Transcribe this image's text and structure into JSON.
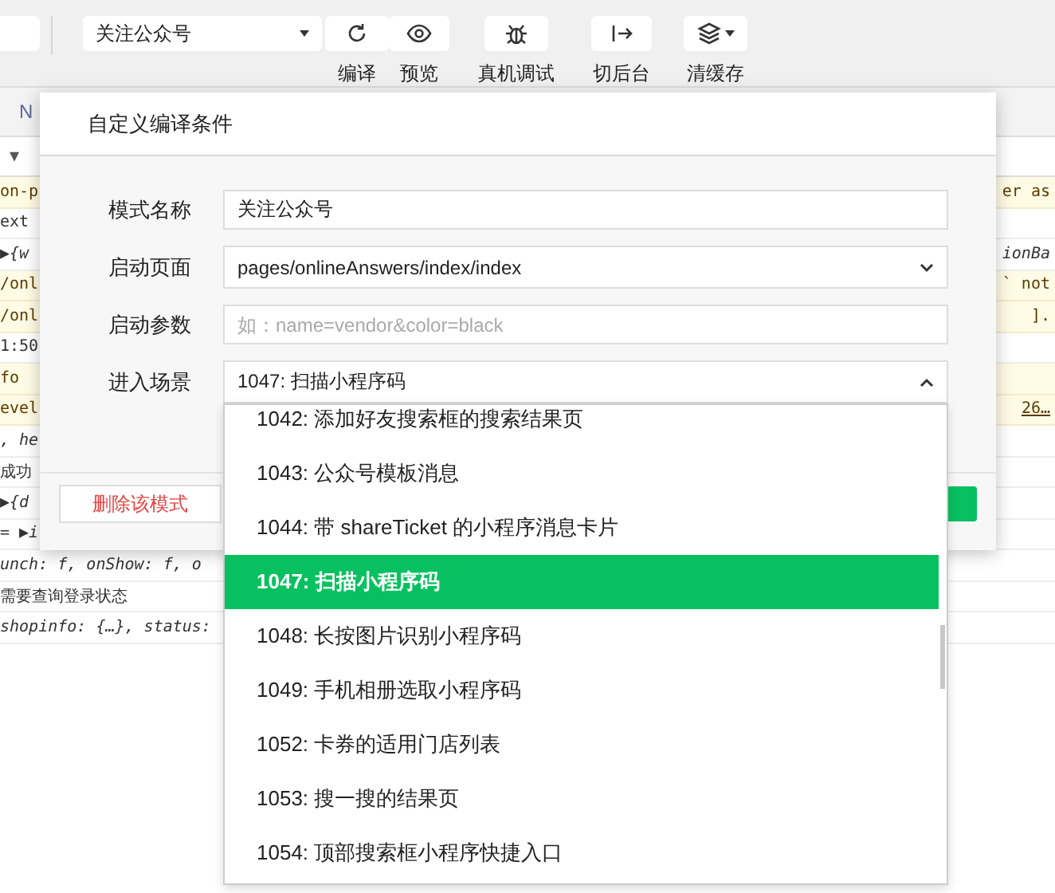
{
  "toolbar": {
    "mode_select": "关注公众号",
    "buttons": [
      {
        "kind": "compile",
        "label": "编译"
      },
      {
        "kind": "preview",
        "label": "预览"
      },
      {
        "kind": "debug",
        "label": "真机调试"
      },
      {
        "kind": "background",
        "label": "切后台"
      },
      {
        "kind": "cache",
        "label": "清缓存"
      }
    ]
  },
  "console": {
    "tab": "N",
    "filter": "▼",
    "rows": [
      {
        "kind": "warning",
        "left": "on-p",
        "right": "er as"
      },
      {
        "kind": "log",
        "left": "ext"
      },
      {
        "kind": "object",
        "left": "▶{w",
        "right": "ionBa"
      },
      {
        "kind": "warning",
        "left": "/onl",
        "right": "` not"
      },
      {
        "kind": "warning",
        "left": "/onl",
        "right": "]."
      },
      {
        "kind": "log",
        "left": "1:50"
      },
      {
        "kind": "warning",
        "left": "fo"
      },
      {
        "kind": "warning",
        "left": "evel",
        "right": "26…",
        "link": true
      },
      {
        "kind": "object",
        "left": ", he"
      },
      {
        "kind": "log",
        "left": "成功"
      },
      {
        "kind": "object",
        "left": "▶{d"
      },
      {
        "kind": "object",
        "left": "= ▶i"
      },
      {
        "kind": "object",
        "left": "unch: f, onShow: f, o"
      },
      {
        "kind": "log",
        "left": "需要查询登录状态"
      },
      {
        "kind": "object",
        "left": "shopinfo: {…}, status:"
      }
    ]
  },
  "dialog": {
    "title": "自定义编译条件",
    "fields": [
      {
        "kind": "text",
        "label": "模式名称",
        "value": "关注公众号"
      },
      {
        "kind": "select",
        "label": "启动页面",
        "value": "pages/onlineAnswers/index/index",
        "expanded": false
      },
      {
        "kind": "text",
        "label": "启动参数",
        "placeholder": "如：name=vendor&color=black"
      },
      {
        "kind": "select",
        "label": "进入场景",
        "value": "1047: 扫描小程序码",
        "expanded": true
      }
    ],
    "delete_button": "删除该模式"
  },
  "scene_dropdown": {
    "options": [
      {
        "label": "1042: 添加好友搜索框的搜索结果页",
        "selected": false
      },
      {
        "label": "1043: 公众号模板消息",
        "selected": false
      },
      {
        "label": "1044: 带 shareTicket 的小程序消息卡片",
        "selected": false
      },
      {
        "label": "1047: 扫描小程序码",
        "selected": true
      },
      {
        "label": "1048: 长按图片识别小程序码",
        "selected": false
      },
      {
        "label": "1049: 手机相册选取小程序码",
        "selected": false
      },
      {
        "label": "1052: 卡券的适用门店列表",
        "selected": false
      },
      {
        "label": "1053: 搜一搜的结果页",
        "selected": false
      },
      {
        "label": "1054: 顶部搜索框小程序快捷入口",
        "selected": false
      }
    ]
  }
}
